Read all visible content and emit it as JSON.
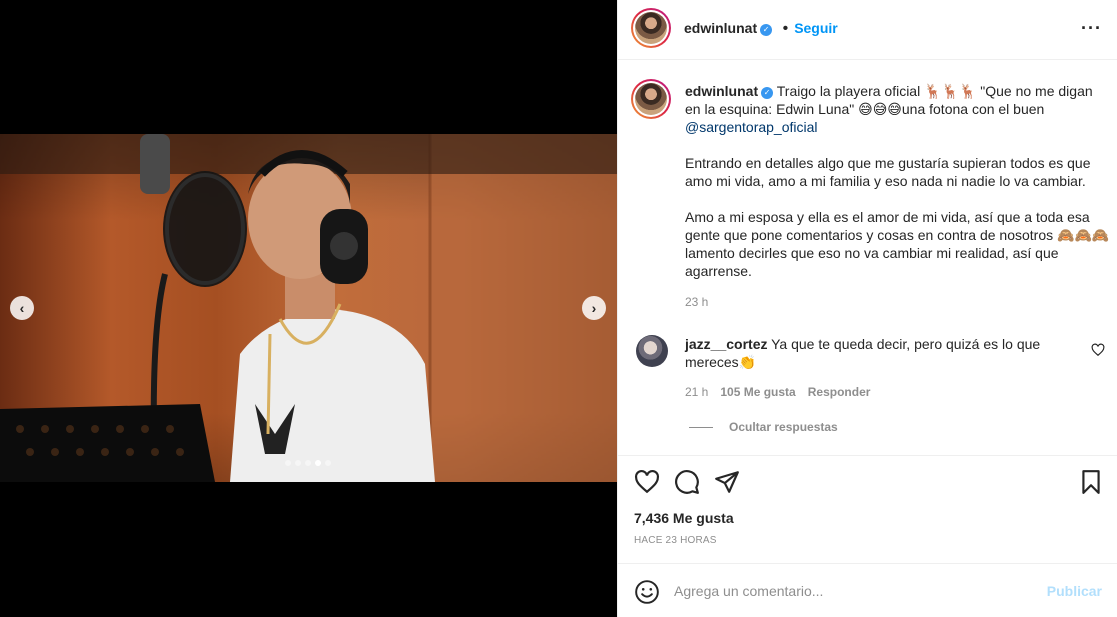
{
  "post": {
    "username": "edwinlunat",
    "verified_icon": "verified-check-icon",
    "bullet": "•",
    "follow_label": "Seguir",
    "more_label": "···"
  },
  "caption": {
    "username": "edwinlunat",
    "line1_text": "Traigo la playera oficial 🦌🦌🦌 \"Que no me digan en la esquina: Edwin Luna\" 😅😅😅una fotona con el buen ",
    "mention": "@sargentorap_oficial",
    "paragraph2": "Entrando en detalles algo que me gustaría supieran todos es que amo mi vida, amo a mi familia y eso nada ni nadie lo va cambiar.",
    "paragraph3": "Amo a mi esposa y ella es el amor de mi vida, así que a toda esa gente que pone comentarios y cosas en contra de nosotros 🙈🙈🙈lamento decirles que eso no va cambiar mi realidad, así que agarrense.",
    "time": "23 h"
  },
  "comment": {
    "username": "jazz__cortez",
    "text": "Ya que te queda decir, pero quizá es lo que mereces👏",
    "time": "21 h",
    "likes": "105 Me gusta",
    "reply_label": "Responder",
    "hide_replies_label": "Ocultar respuestas"
  },
  "stats": {
    "likes": "7,436 Me gusta",
    "ago": "HACE 23 HORAS"
  },
  "composer": {
    "placeholder": "Agrega un comentario...",
    "publish_label": "Publicar"
  },
  "carousel": {
    "prev_glyph": "‹",
    "next_glyph": "›",
    "slide_count": 5,
    "active_index": 3
  },
  "colors": {
    "accent": "#0095f6",
    "publish_disabled": "#b2dffc",
    "muted": "#8e8e8e",
    "mention": "#00376b"
  }
}
